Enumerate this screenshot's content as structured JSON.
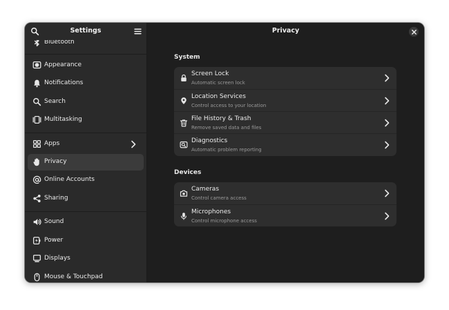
{
  "sidebar": {
    "title": "Settings",
    "items": [
      {
        "label": "Bluetooth",
        "icon": "bluetooth-icon"
      },
      {
        "label": "Appearance",
        "icon": "appearance-icon"
      },
      {
        "label": "Notifications",
        "icon": "bell-icon"
      },
      {
        "label": "Search",
        "icon": "search-icon"
      },
      {
        "label": "Multitasking",
        "icon": "multitasking-icon"
      },
      {
        "label": "Apps",
        "icon": "apps-grid-icon"
      },
      {
        "label": "Privacy",
        "icon": "hand-icon"
      },
      {
        "label": "Online Accounts",
        "icon": "at-sign-icon"
      },
      {
        "label": "Sharing",
        "icon": "share-icon"
      },
      {
        "label": "Sound",
        "icon": "speaker-icon"
      },
      {
        "label": "Power",
        "icon": "power-icon"
      },
      {
        "label": "Displays",
        "icon": "display-icon"
      },
      {
        "label": "Mouse & Touchpad",
        "icon": "mouse-icon"
      }
    ],
    "selected": "Privacy"
  },
  "main": {
    "title": "Privacy",
    "sections": [
      {
        "title": "System",
        "rows": [
          {
            "title": "Screen Lock",
            "subtitle": "Automatic screen lock",
            "icon": "lock-icon"
          },
          {
            "title": "Location Services",
            "subtitle": "Control access to your location",
            "icon": "location-pin-icon"
          },
          {
            "title": "File History & Trash",
            "subtitle": "Remove saved data and files",
            "icon": "trash-icon"
          },
          {
            "title": "Diagnostics",
            "subtitle": "Automatic problem reporting",
            "icon": "diagnostics-icon"
          }
        ]
      },
      {
        "title": "Devices",
        "rows": [
          {
            "title": "Cameras",
            "subtitle": "Control camera access",
            "icon": "camera-icon"
          },
          {
            "title": "Microphones",
            "subtitle": "Control microphone access",
            "icon": "microphone-icon"
          }
        ]
      }
    ]
  },
  "colors": {
    "window_bg": "#1e1e1e",
    "sidebar_bg": "#2a2a2a",
    "card_bg": "#2e2e2e",
    "selected_bg": "#3b3b3b"
  }
}
